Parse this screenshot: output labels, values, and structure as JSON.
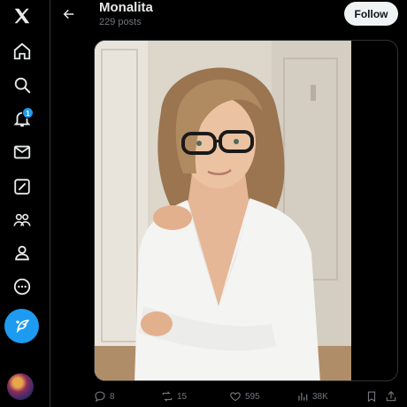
{
  "header": {
    "title": "Monalita",
    "subtitle": "229 posts",
    "follow_label": "Follow"
  },
  "nav": {
    "items": [
      {
        "icon": "x-logo-icon"
      },
      {
        "icon": "home-icon"
      },
      {
        "icon": "search-icon"
      },
      {
        "icon": "bell-icon",
        "badge": "1"
      },
      {
        "icon": "mail-icon"
      },
      {
        "icon": "grok-icon"
      },
      {
        "icon": "communities-icon"
      },
      {
        "icon": "profile-icon"
      },
      {
        "icon": "more-icon"
      },
      {
        "icon": "compose-icon"
      },
      {
        "icon": "avatar"
      }
    ]
  },
  "post": {
    "image_alt": "woman in glasses and white blazer",
    "replies": "8",
    "reposts": "15",
    "likes": "595",
    "views": "38K"
  },
  "colors": {
    "accent": "#1d9bf0",
    "muted": "#71767b",
    "text": "#e7e9ea",
    "background": "#000000",
    "border": "#2f3336"
  }
}
